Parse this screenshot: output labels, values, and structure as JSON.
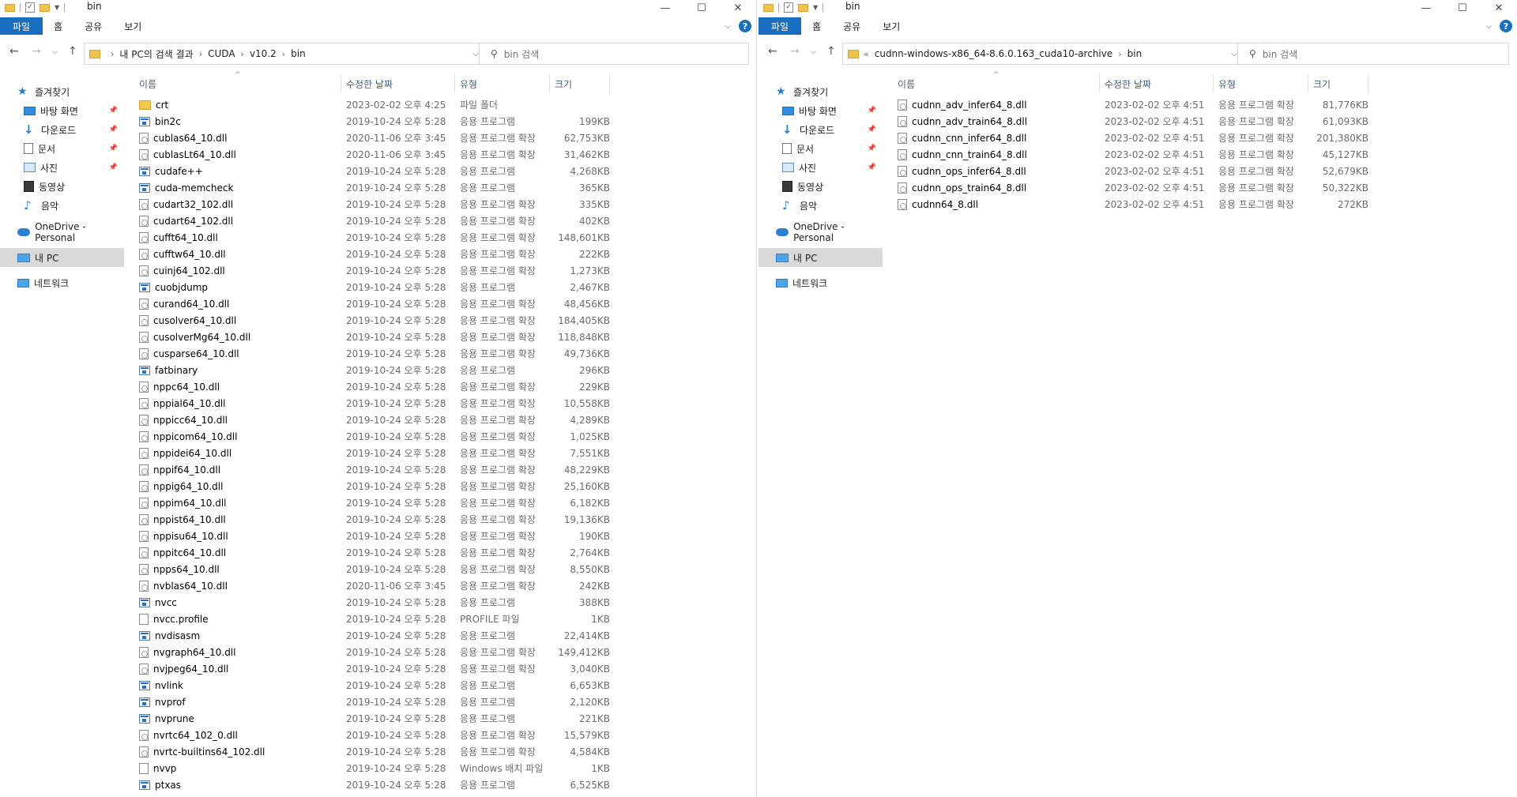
{
  "left": {
    "title": "bin",
    "ribbon_tabs": [
      "파일",
      "홈",
      "공유",
      "보기"
    ],
    "breadcrumb": [
      "내 PC의 검색 결과",
      "CUDA",
      "v10.2",
      "bin"
    ],
    "search_placeholder": "bin 검색",
    "sidebar": [
      {
        "label": "즐겨찾기",
        "icon": "star-icon"
      },
      {
        "label": "바탕 화면",
        "icon": "desktop-icon",
        "pinned": true
      },
      {
        "label": "다운로드",
        "icon": "download-icon",
        "pinned": true
      },
      {
        "label": "문서",
        "icon": "document-icon",
        "pinned": true
      },
      {
        "label": "사진",
        "icon": "pictures-icon",
        "pinned": true
      },
      {
        "label": "동영상",
        "icon": "videos-icon"
      },
      {
        "label": "음악",
        "icon": "music-icon"
      },
      {
        "label": "OneDrive - Personal",
        "icon": "onedrive-icon"
      },
      {
        "label": "내 PC",
        "icon": "this-pc-icon",
        "selected": true
      },
      {
        "label": "네트워크",
        "icon": "network-icon"
      }
    ],
    "columns": [
      "이름",
      "수정한 날짜",
      "유형",
      "크기"
    ],
    "files": [
      {
        "name": "crt",
        "date": "2023-02-02 오후 4:25",
        "type": "파일 폴더",
        "size": "",
        "icon": "folder"
      },
      {
        "name": "bin2c",
        "date": "2019-10-24 오후 5:28",
        "type": "응용 프로그램",
        "size": "199KB",
        "icon": "exe"
      },
      {
        "name": "cublas64_10.dll",
        "date": "2020-11-06 오후 3:45",
        "type": "응용 프로그램 확장",
        "size": "62,753KB",
        "icon": "dll"
      },
      {
        "name": "cublasLt64_10.dll",
        "date": "2020-11-06 오후 3:45",
        "type": "응용 프로그램 확장",
        "size": "31,462KB",
        "icon": "dll"
      },
      {
        "name": "cudafe++",
        "date": "2019-10-24 오후 5:28",
        "type": "응용 프로그램",
        "size": "4,268KB",
        "icon": "exe"
      },
      {
        "name": "cuda-memcheck",
        "date": "2019-10-24 오후 5:28",
        "type": "응용 프로그램",
        "size": "365KB",
        "icon": "exe"
      },
      {
        "name": "cudart32_102.dll",
        "date": "2019-10-24 오후 5:28",
        "type": "응용 프로그램 확장",
        "size": "335KB",
        "icon": "dll"
      },
      {
        "name": "cudart64_102.dll",
        "date": "2019-10-24 오후 5:28",
        "type": "응용 프로그램 확장",
        "size": "402KB",
        "icon": "dll"
      },
      {
        "name": "cufft64_10.dll",
        "date": "2019-10-24 오후 5:28",
        "type": "응용 프로그램 확장",
        "size": "148,601KB",
        "icon": "dll"
      },
      {
        "name": "cufftw64_10.dll",
        "date": "2019-10-24 오후 5:28",
        "type": "응용 프로그램 확장",
        "size": "222KB",
        "icon": "dll"
      },
      {
        "name": "cuinj64_102.dll",
        "date": "2019-10-24 오후 5:28",
        "type": "응용 프로그램 확장",
        "size": "1,273KB",
        "icon": "dll"
      },
      {
        "name": "cuobjdump",
        "date": "2019-10-24 오후 5:28",
        "type": "응용 프로그램",
        "size": "2,467KB",
        "icon": "exe"
      },
      {
        "name": "curand64_10.dll",
        "date": "2019-10-24 오후 5:28",
        "type": "응용 프로그램 확장",
        "size": "48,456KB",
        "icon": "dll"
      },
      {
        "name": "cusolver64_10.dll",
        "date": "2019-10-24 오후 5:28",
        "type": "응용 프로그램 확장",
        "size": "184,405KB",
        "icon": "dll"
      },
      {
        "name": "cusolverMg64_10.dll",
        "date": "2019-10-24 오후 5:28",
        "type": "응용 프로그램 확장",
        "size": "118,848KB",
        "icon": "dll"
      },
      {
        "name": "cusparse64_10.dll",
        "date": "2019-10-24 오후 5:28",
        "type": "응용 프로그램 확장",
        "size": "49,736KB",
        "icon": "dll"
      },
      {
        "name": "fatbinary",
        "date": "2019-10-24 오후 5:28",
        "type": "응용 프로그램",
        "size": "296KB",
        "icon": "exe"
      },
      {
        "name": "nppc64_10.dll",
        "date": "2019-10-24 오후 5:28",
        "type": "응용 프로그램 확장",
        "size": "229KB",
        "icon": "dll"
      },
      {
        "name": "nppial64_10.dll",
        "date": "2019-10-24 오후 5:28",
        "type": "응용 프로그램 확장",
        "size": "10,558KB",
        "icon": "dll"
      },
      {
        "name": "nppicc64_10.dll",
        "date": "2019-10-24 오후 5:28",
        "type": "응용 프로그램 확장",
        "size": "4,289KB",
        "icon": "dll"
      },
      {
        "name": "nppicom64_10.dll",
        "date": "2019-10-24 오후 5:28",
        "type": "응용 프로그램 확장",
        "size": "1,025KB",
        "icon": "dll"
      },
      {
        "name": "nppidei64_10.dll",
        "date": "2019-10-24 오후 5:28",
        "type": "응용 프로그램 확장",
        "size": "7,551KB",
        "icon": "dll"
      },
      {
        "name": "nppif64_10.dll",
        "date": "2019-10-24 오후 5:28",
        "type": "응용 프로그램 확장",
        "size": "48,229KB",
        "icon": "dll"
      },
      {
        "name": "nppig64_10.dll",
        "date": "2019-10-24 오후 5:28",
        "type": "응용 프로그램 확장",
        "size": "25,160KB",
        "icon": "dll"
      },
      {
        "name": "nppim64_10.dll",
        "date": "2019-10-24 오후 5:28",
        "type": "응용 프로그램 확장",
        "size": "6,182KB",
        "icon": "dll"
      },
      {
        "name": "nppist64_10.dll",
        "date": "2019-10-24 오후 5:28",
        "type": "응용 프로그램 확장",
        "size": "19,136KB",
        "icon": "dll"
      },
      {
        "name": "nppisu64_10.dll",
        "date": "2019-10-24 오후 5:28",
        "type": "응용 프로그램 확장",
        "size": "190KB",
        "icon": "dll"
      },
      {
        "name": "nppitc64_10.dll",
        "date": "2019-10-24 오후 5:28",
        "type": "응용 프로그램 확장",
        "size": "2,764KB",
        "icon": "dll"
      },
      {
        "name": "npps64_10.dll",
        "date": "2019-10-24 오후 5:28",
        "type": "응용 프로그램 확장",
        "size": "8,550KB",
        "icon": "dll"
      },
      {
        "name": "nvblas64_10.dll",
        "date": "2020-11-06 오후 3:45",
        "type": "응용 프로그램 확장",
        "size": "242KB",
        "icon": "dll"
      },
      {
        "name": "nvcc",
        "date": "2019-10-24 오후 5:28",
        "type": "응용 프로그램",
        "size": "388KB",
        "icon": "exe"
      },
      {
        "name": "nvcc.profile",
        "date": "2019-10-24 오후 5:28",
        "type": "PROFILE 파일",
        "size": "1KB",
        "icon": "doc"
      },
      {
        "name": "nvdisasm",
        "date": "2019-10-24 오후 5:28",
        "type": "응용 프로그램",
        "size": "22,414KB",
        "icon": "exe"
      },
      {
        "name": "nvgraph64_10.dll",
        "date": "2019-10-24 오후 5:28",
        "type": "응용 프로그램 확장",
        "size": "149,412KB",
        "icon": "dll"
      },
      {
        "name": "nvjpeg64_10.dll",
        "date": "2019-10-24 오후 5:28",
        "type": "응용 프로그램 확장",
        "size": "3,040KB",
        "icon": "dll"
      },
      {
        "name": "nvlink",
        "date": "2019-10-24 오후 5:28",
        "type": "응용 프로그램",
        "size": "6,653KB",
        "icon": "exe"
      },
      {
        "name": "nvprof",
        "date": "2019-10-24 오후 5:28",
        "type": "응용 프로그램",
        "size": "2,120KB",
        "icon": "exe"
      },
      {
        "name": "nvprune",
        "date": "2019-10-24 오후 5:28",
        "type": "응용 프로그램",
        "size": "221KB",
        "icon": "exe"
      },
      {
        "name": "nvrtc64_102_0.dll",
        "date": "2019-10-24 오후 5:28",
        "type": "응용 프로그램 확장",
        "size": "15,579KB",
        "icon": "dll"
      },
      {
        "name": "nvrtc-builtins64_102.dll",
        "date": "2019-10-24 오후 5:28",
        "type": "응용 프로그램 확장",
        "size": "4,584KB",
        "icon": "dll"
      },
      {
        "name": "nvvp",
        "date": "2019-10-24 오후 5:28",
        "type": "Windows 배치 파일",
        "size": "1KB",
        "icon": "doc"
      },
      {
        "name": "ptxas",
        "date": "2019-10-24 오후 5:28",
        "type": "응용 프로그램",
        "size": "6,525KB",
        "icon": "exe"
      }
    ]
  },
  "right": {
    "title": "bin",
    "ribbon_tabs": [
      "파일",
      "홈",
      "공유",
      "보기"
    ],
    "breadcrumb_prefix": "«",
    "breadcrumb": [
      "cudnn-windows-x86_64-8.6.0.163_cuda10-archive",
      "bin"
    ],
    "search_placeholder": "bin 검색",
    "sidebar": [
      {
        "label": "즐겨찾기",
        "icon": "star-icon"
      },
      {
        "label": "바탕 화면",
        "icon": "desktop-icon",
        "pinned": true
      },
      {
        "label": "다운로드",
        "icon": "download-icon",
        "pinned": true
      },
      {
        "label": "문서",
        "icon": "document-icon",
        "pinned": true
      },
      {
        "label": "사진",
        "icon": "pictures-icon",
        "pinned": true
      },
      {
        "label": "동영상",
        "icon": "videos-icon"
      },
      {
        "label": "음악",
        "icon": "music-icon"
      },
      {
        "label": "OneDrive - Personal",
        "icon": "onedrive-icon"
      },
      {
        "label": "내 PC",
        "icon": "this-pc-icon",
        "selected": true
      },
      {
        "label": "네트워크",
        "icon": "network-icon"
      }
    ],
    "columns": [
      "이름",
      "수정한 날짜",
      "유형",
      "크기"
    ],
    "files": [
      {
        "name": "cudnn_adv_infer64_8.dll",
        "date": "2023-02-02 오후 4:51",
        "type": "응용 프로그램 확장",
        "size": "81,776KB",
        "icon": "dll"
      },
      {
        "name": "cudnn_adv_train64_8.dll",
        "date": "2023-02-02 오후 4:51",
        "type": "응용 프로그램 확장",
        "size": "61,093KB",
        "icon": "dll"
      },
      {
        "name": "cudnn_cnn_infer64_8.dll",
        "date": "2023-02-02 오후 4:51",
        "type": "응용 프로그램 확장",
        "size": "201,380KB",
        "icon": "dll"
      },
      {
        "name": "cudnn_cnn_train64_8.dll",
        "date": "2023-02-02 오후 4:51",
        "type": "응용 프로그램 확장",
        "size": "45,127KB",
        "icon": "dll"
      },
      {
        "name": "cudnn_ops_infer64_8.dll",
        "date": "2023-02-02 오후 4:51",
        "type": "응용 프로그램 확장",
        "size": "52,679KB",
        "icon": "dll"
      },
      {
        "name": "cudnn_ops_train64_8.dll",
        "date": "2023-02-02 오후 4:51",
        "type": "응용 프로그램 확장",
        "size": "50,322KB",
        "icon": "dll"
      },
      {
        "name": "cudnn64_8.dll",
        "date": "2023-02-02 오후 4:51",
        "type": "응용 프로그램 확장",
        "size": "272KB",
        "icon": "dll"
      }
    ]
  },
  "window_controls": {
    "minimize": "—",
    "maximize": "☐",
    "close": "✕"
  },
  "colors": {
    "file_tab": "#1a6ec2",
    "header_text": "#4c607a",
    "folder": "#f2c94c"
  }
}
